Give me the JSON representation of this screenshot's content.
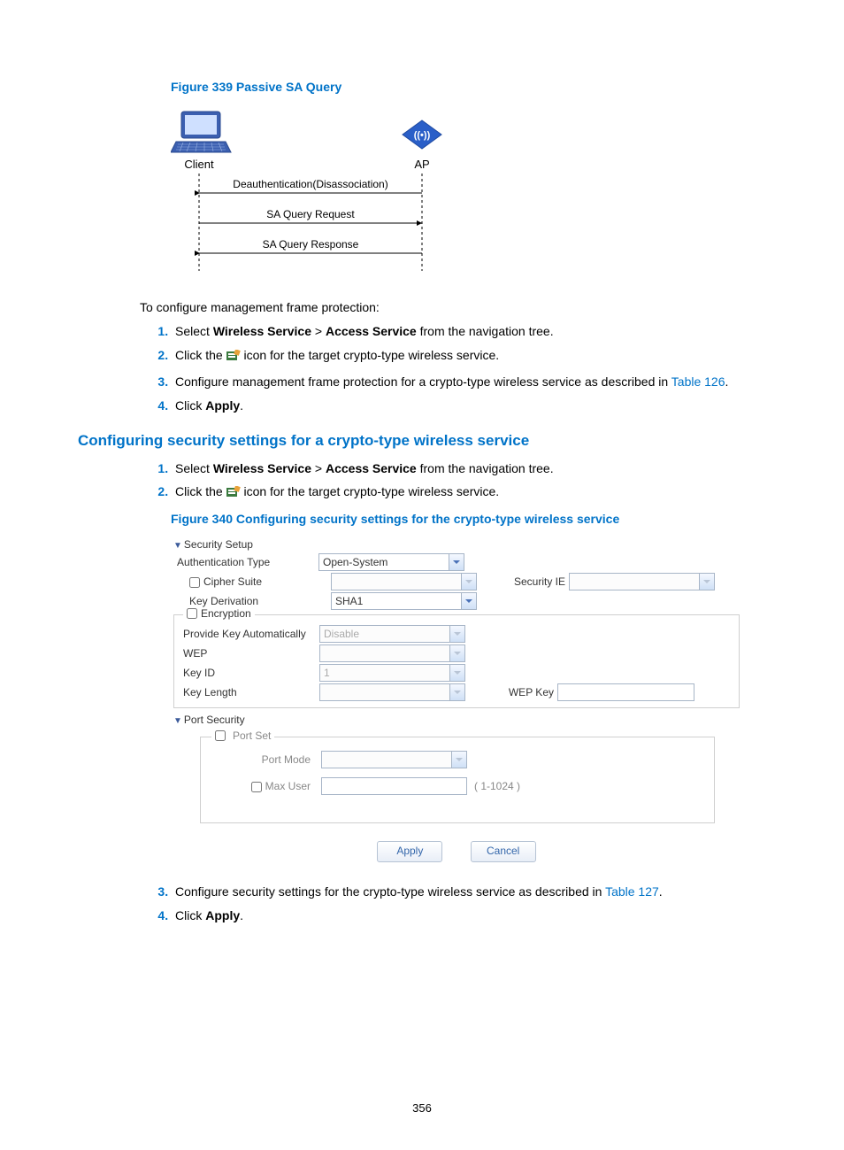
{
  "figures": {
    "f339_caption": "Figure 339 Passive SA Query",
    "f340_caption": "Figure 340 Configuring security settings for the crypto-type wireless service"
  },
  "diagram": {
    "client_label": "Client",
    "ap_label": "AP",
    "msg1": "Deauthentication(Disassociation)",
    "msg2": "SA Query Request",
    "msg3": "SA Query Response"
  },
  "intro1": "To configure management frame protection:",
  "steps_a": {
    "s1_pre": "Select ",
    "s1_b1": "Wireless Service",
    "s1_mid": " > ",
    "s1_b2": "Access Service",
    "s1_post": " from the navigation tree.",
    "s2_pre": "Click the ",
    "s2_post": " icon for the target crypto-type wireless service.",
    "s3_pre": "Configure management frame protection for a crypto-type wireless service as described in ",
    "s3_link": "Table 126",
    "s3_post": ".",
    "s4_pre": "Click ",
    "s4_b": "Apply",
    "s4_post": "."
  },
  "section_heading": "Configuring security settings for a crypto-type wireless service",
  "steps_b": {
    "s1_pre": "Select ",
    "s1_b1": "Wireless Service",
    "s1_mid": " > ",
    "s1_b2": "Access Service",
    "s1_post": " from the navigation tree.",
    "s2_pre": "Click the ",
    "s2_post": " icon for the target crypto-type wireless service.",
    "s3_pre": "Configure security settings for the crypto-type wireless service as described in ",
    "s3_link": "Table 127",
    "s3_post": ".",
    "s4_pre": "Click ",
    "s4_b": "Apply",
    "s4_post": "."
  },
  "ui": {
    "security_setup_header": "Security Setup",
    "auth_type_label": "Authentication Type",
    "auth_type_value": "Open-System",
    "cipher_suite_label": "Cipher Suite",
    "cipher_suite_value": "",
    "security_ie_label": "Security IE",
    "security_ie_value": "",
    "key_derivation_label": "Key Derivation",
    "key_derivation_value": "SHA1",
    "encryption_legend": "Encryption",
    "provide_key_label": "Provide Key Automatically",
    "provide_key_value": "Disable",
    "wep_label": "WEP",
    "wep_value": "",
    "key_id_label": "Key ID",
    "key_id_value": "1",
    "key_length_label": "Key Length",
    "key_length_value": "",
    "wep_key_label": "WEP Key",
    "wep_key_value": "",
    "port_security_header": "Port Security",
    "port_set_legend": "Port Set",
    "port_mode_label": "Port Mode",
    "port_mode_value": "",
    "max_user_label": "Max User",
    "max_user_value": "",
    "max_user_hint": "( 1-1024 )",
    "apply_btn": "Apply",
    "cancel_btn": "Cancel"
  },
  "page_number": "356"
}
